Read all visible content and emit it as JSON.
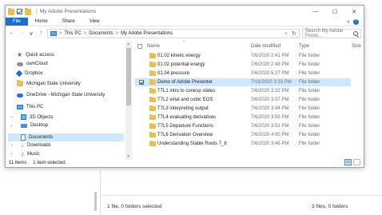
{
  "window": {
    "title": "My Adobe Presentations",
    "controls": {
      "minimize": "—",
      "maximize": "☐",
      "close": "✕"
    }
  },
  "ribbon": {
    "tabs": [
      "File",
      "Home",
      "Share",
      "View"
    ],
    "collapse": "∨",
    "help": "?"
  },
  "address": {
    "back": "←",
    "forward": "→",
    "recent": "∨",
    "up": "↑",
    "crumbs": [
      "This PC",
      "Documents",
      "My Adobe Presentations"
    ],
    "separator": ">",
    "dropdown": "∨",
    "refresh": "↻",
    "search_placeholder": "Search My Adobe Prese..."
  },
  "nav": {
    "items": [
      {
        "label": "Quick access",
        "icon": "star-icon"
      },
      {
        "label": "ownCloud",
        "icon": "cloud-icon"
      },
      {
        "label": "Dropbox",
        "icon": "dropbox-icon"
      },
      {
        "label": "Michigan State University",
        "icon": "folder-icon"
      },
      {
        "label": "OneDrive - Michigan State University",
        "icon": "onedrive-icon"
      },
      {
        "label": "This PC",
        "icon": "pc-icon"
      },
      {
        "label": "3D Objects",
        "icon": "3d-objects-icon"
      },
      {
        "label": "Desktop",
        "icon": "desktop-icon"
      },
      {
        "label": "Documents",
        "icon": "documents-icon",
        "selected": true
      },
      {
        "label": "Downloads",
        "icon": "downloads-icon"
      },
      {
        "label": "Music",
        "icon": "music-icon"
      }
    ],
    "expand_glyph": ">",
    "scroll_up": "▲",
    "scroll_down": "▼"
  },
  "columns": {
    "name": "Name",
    "date": "Date modified",
    "type": "Type",
    "size": "Size",
    "sort_caret": "^"
  },
  "files": [
    {
      "name": "01.02 kinetic energy",
      "date": "7/6/2020 2:41 PM",
      "type": "File folder"
    },
    {
      "name": "01.02 potential energy",
      "date": "7/6/2020 2:48 PM",
      "type": "File folder"
    },
    {
      "name": "01.04 pressure",
      "date": "7/6/2020 5:27 PM",
      "type": "File folder"
    },
    {
      "name": "Demo of Adobe Presenter",
      "date": "7/16/2020 3:33 PM",
      "type": "File folder",
      "selected": true
    },
    {
      "name": "T7L1 intro to conesp states",
      "date": "7/6/2020 3:32 PM",
      "type": "File folder"
    },
    {
      "name": "T7L2 virial and cubic EOS",
      "date": "7/6/2020 3:37 PM",
      "type": "File folder"
    },
    {
      "name": "T7L3 interpreting output",
      "date": "7/6/2020 3:44 PM",
      "type": "File folder"
    },
    {
      "name": "T7L4 evaluating derivatives",
      "date": "7/6/2020 3:55 PM",
      "type": "File folder"
    },
    {
      "name": "T7L5 Departure Functions",
      "date": "7/6/2020 3:51 PM",
      "type": "File folder"
    },
    {
      "name": "T7L6 Derivation Overview",
      "date": "7/6/2020 4:00 PM",
      "type": "File folder"
    },
    {
      "name": "Understanding Stable Roots 7_6",
      "date": "7/6/2020 3:46 PM",
      "type": "File folder"
    }
  ],
  "status": {
    "count": "11 items",
    "selected": "1 item selected"
  },
  "background_app": {
    "status_left": "1 file, 0 folders selected",
    "status_right": "3 files, 0 folders"
  },
  "colors": {
    "accent": "#1f6fc5",
    "selection": "#cde8ff",
    "folder": "#e8c052"
  }
}
